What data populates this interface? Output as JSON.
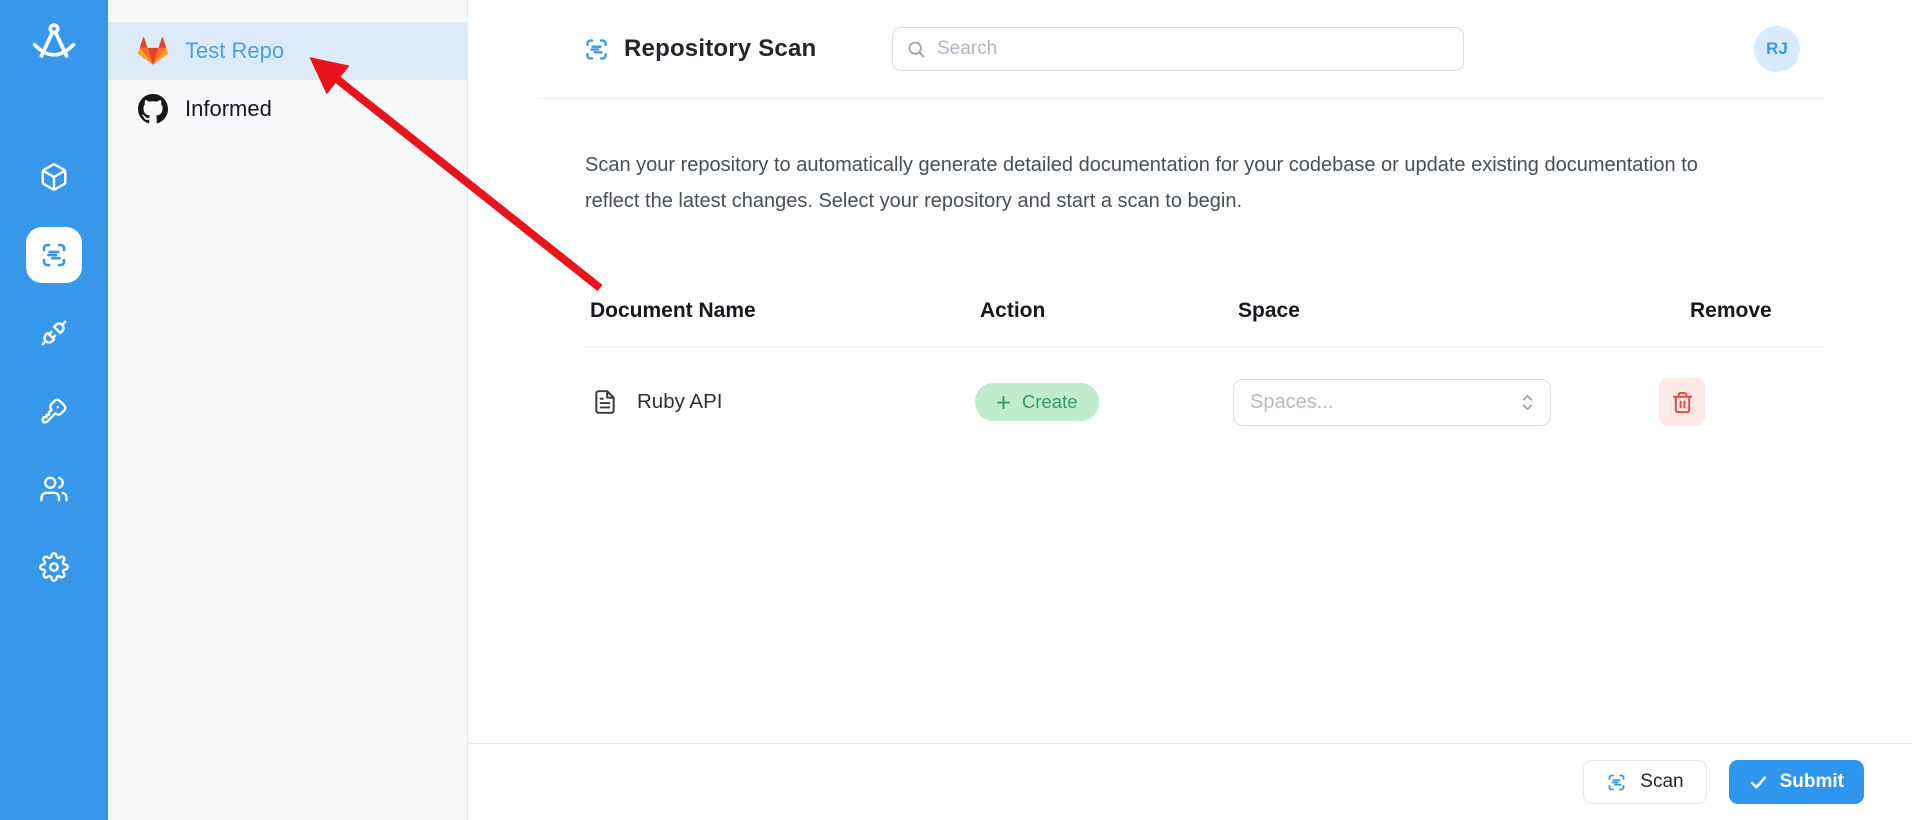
{
  "sidebar": {
    "logo_icon": "drafting-compass",
    "nav": [
      {
        "icon": "package-box",
        "active": false
      },
      {
        "icon": "repository-scan",
        "active": true
      },
      {
        "icon": "plug-connection",
        "active": false
      },
      {
        "icon": "key",
        "active": false
      },
      {
        "icon": "users",
        "active": false
      },
      {
        "icon": "settings-gear",
        "active": false
      }
    ]
  },
  "repo_panel": {
    "items": [
      {
        "label": "Test Repo",
        "icon": "gitlab",
        "active": true
      },
      {
        "label": "Informed",
        "icon": "github",
        "active": false
      }
    ]
  },
  "header": {
    "title": "Repository Scan",
    "title_icon": "scan",
    "search_placeholder": "Search",
    "avatar_initials": "RJ"
  },
  "main": {
    "description": "Scan your repository to automatically generate detailed documentation for your codebase or update existing documentation to reflect the latest changes. Select your repository and start a scan to begin.",
    "table": {
      "columns": [
        "Document Name",
        "Action",
        "Space",
        "Remove"
      ],
      "rows": [
        {
          "document_name": "Ruby API",
          "doc_icon": "file-text",
          "action_label": "Create",
          "action_icon": "plus",
          "space_placeholder": "Spaces...",
          "remove_icon": "trash"
        }
      ]
    }
  },
  "footer": {
    "scan_label": "Scan",
    "submit_label": "Submit"
  },
  "annotation": {
    "arrow_color": "#e8141b",
    "arrow_points_to": "Test Repo"
  },
  "colors": {
    "sidebar_blue": "#3797ea",
    "accent_blue": "#3b96e9",
    "active_repo_bg": "#ddeafa",
    "active_repo_text": "#4aa0e8",
    "create_bg": "#c0edcf",
    "create_text": "#2e9e5f",
    "danger": "#e5483f",
    "danger_bg": "#fdeae8",
    "avatar_bg": "#d8eafc"
  }
}
